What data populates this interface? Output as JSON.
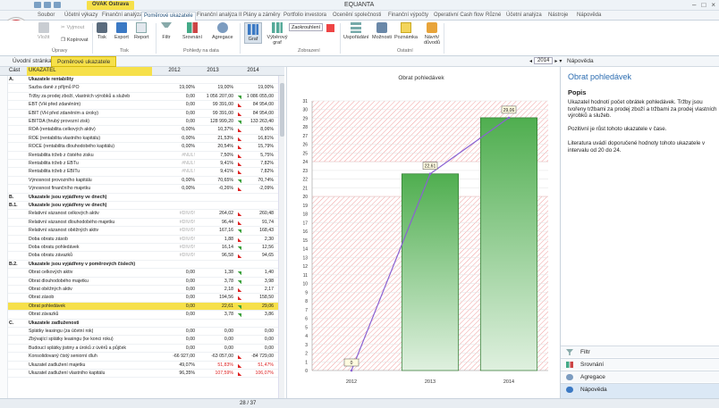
{
  "app": {
    "title": "EQUANTA",
    "context_badge": "OVAK Ostrava"
  },
  "tabs": [
    "Soubor",
    "Účetní výkazy",
    "Finanční analýza",
    "Poměrové ukazatele",
    "Finanční analýza II",
    "Plány a záměry",
    "Portfolio investora",
    "Ocenění společnosti",
    "Finanční výpočty",
    "Operativní Cash flow",
    "Různé",
    "Účetní analýza",
    "Nástroje",
    "Nápověda"
  ],
  "ribbon": {
    "buttons": {
      "vlozit": "Vložit",
      "vyjmout": "Vyjmout",
      "kopirovat": "Kopírovat",
      "tisk": "Tisk",
      "export": "Export",
      "report": "Report",
      "filtr": "Filtr",
      "srovnani": "Srovnání",
      "agregace": "Agregace",
      "graf": "Graf",
      "vyberovy": "Výběrový graf",
      "zaokrouhleni": "Zaokrouhlení",
      "uspoladani": "Uspořádání",
      "moznosti": "Možnosti",
      "poznamka": "Poznámka",
      "navrh": "Návrh/ důvodů"
    },
    "groups": {
      "upravy": "Úpravy",
      "tisk": "Tisk",
      "pohledy": "Pohledy na data",
      "zobrazeni": "Zobrazení",
      "ostatni": "Ostatní"
    }
  },
  "subbar": {
    "tab1": "Úvodní stránka",
    "tab2": "Poměrové ukazatele",
    "year": "2014",
    "right_title": "Nápověda"
  },
  "table": {
    "h_cast": "Část",
    "h_name": "UKAZATEL",
    "years": [
      "2012",
      "2013",
      "2014"
    ],
    "rows": [
      {
        "code": "A.",
        "name": "Ukazatele rentability",
        "v": [
          "",
          "",
          ""
        ],
        "sec": true
      },
      {
        "code": "",
        "name": "Sazba daně z příjmů PO",
        "v": [
          "19,00%",
          "19,00%",
          "19,00%"
        ]
      },
      {
        "code": "",
        "name": "Tržby za prodej zboží, vlastních výrobků a služeb",
        "v": [
          "0,00",
          "1 056 207,00",
          "1 086 055,00"
        ],
        "m": "up"
      },
      {
        "code": "",
        "name": "EBT (VH před zdaněním)",
        "v": [
          "0,00",
          "99 391,00",
          "84 954,00"
        ],
        "m": "dn"
      },
      {
        "code": "",
        "name": "EBIT (VH před zdaněním a úroky)",
        "v": [
          "0,00",
          "99 391,00",
          "84 954,00"
        ],
        "m": "dn"
      },
      {
        "code": "",
        "name": "EBITDA (hrubý provozní zisk)",
        "v": [
          "0,00",
          "128 999,20",
          "133 263,40"
        ],
        "m": "up"
      },
      {
        "code": "",
        "name": "ROA (rentabilita celkových aktiv)",
        "v": [
          "0,00%",
          "10,37%",
          "8,06%"
        ],
        "m": "dn"
      },
      {
        "code": "",
        "name": "ROE (rentabilita vlastního kapitálu)",
        "v": [
          "0,00%",
          "21,53%",
          "16,81%"
        ],
        "m": "dn"
      },
      {
        "code": "",
        "name": "ROCE (rentabilita dlouhodobého kapitálu)",
        "v": [
          "0,00%",
          "20,54%",
          "15,79%"
        ],
        "m": "dn"
      },
      {
        "code": "",
        "name": "Rentabilita tržeb z čistého zisku",
        "v": [
          "#NUL!",
          "7,50%",
          "5,75%"
        ],
        "m": "dn",
        "g": true
      },
      {
        "code": "",
        "name": "Rentabilita tržeb z EBTu",
        "v": [
          "#NUL!",
          "9,41%",
          "7,82%"
        ],
        "m": "dn",
        "g": true
      },
      {
        "code": "",
        "name": "Rentabilita tržeb z EBITu",
        "v": [
          "#NUL!",
          "9,41%",
          "7,82%"
        ],
        "m": "dn",
        "g": true
      },
      {
        "code": "",
        "name": "Výnosnost provozního kapitálu",
        "v": [
          "0,00%",
          "70,65%",
          "70,74%"
        ],
        "m": "up"
      },
      {
        "code": "",
        "name": "Výnosnost finančního majetku",
        "v": [
          "0,00%",
          "-0,26%",
          "-2,09%"
        ],
        "m": "dn"
      },
      {
        "code": "B.",
        "name": "Ukazatele jsou vyjádřeny ve dnech)",
        "v": [
          "",
          "",
          ""
        ],
        "sec": true
      },
      {
        "code": "B.1.",
        "name": "Ukazatele jsou vyjádřeny ve dnech)",
        "v": [
          "",
          "",
          ""
        ],
        "sec": true
      },
      {
        "code": "",
        "name": "Relativní vázanost celkových aktiv",
        "v": [
          "#DIV/0!",
          "264,02",
          "260,48"
        ],
        "m": "dn",
        "g": true
      },
      {
        "code": "",
        "name": "Relativní vázanost dlouhodobého majetku",
        "v": [
          "#DIV/0!",
          "96,44",
          "91,74"
        ],
        "m": "dn",
        "g": true
      },
      {
        "code": "",
        "name": "Relativní vázanost oběžných aktiv",
        "v": [
          "#DIV/0!",
          "167,16",
          "168,43"
        ],
        "m": "up",
        "g": true
      },
      {
        "code": "",
        "name": "Doba obratu zásob",
        "v": [
          "#DIV/0!",
          "1,88",
          "2,30"
        ],
        "m": "dn",
        "g": true
      },
      {
        "code": "",
        "name": "Doba obratu pohledávek",
        "v": [
          "#DIV/0!",
          "16,14",
          "12,56"
        ],
        "m": "up",
        "g": true
      },
      {
        "code": "",
        "name": "Doba obratu závazků",
        "v": [
          "#DIV/0!",
          "96,58",
          "94,65"
        ],
        "m": "dn",
        "g": true
      },
      {
        "code": "B.2.",
        "name": "Ukazatele jsou vyjádřeny v poměrových číslech)",
        "v": [
          "",
          "",
          ""
        ],
        "sec": true
      },
      {
        "code": "",
        "name": "Obrat celkových aktiv",
        "v": [
          "0,00",
          "1,38",
          "1,40"
        ],
        "m": "up"
      },
      {
        "code": "",
        "name": "Obrat dlouhodobého majetku",
        "v": [
          "0,00",
          "3,78",
          "3,98"
        ],
        "m": "up"
      },
      {
        "code": "",
        "name": "Obrat oběžných aktiv",
        "v": [
          "0,00",
          "2,18",
          "2,17"
        ],
        "m": "dn"
      },
      {
        "code": "",
        "name": "Obrat zásob",
        "v": [
          "0,00",
          "194,56",
          "158,50"
        ],
        "m": "dn"
      },
      {
        "code": "",
        "name": "Obrat pohledávek",
        "v": [
          "0,00",
          "22,61",
          "29,06"
        ],
        "m": "up",
        "hl": true
      },
      {
        "code": "",
        "name": "Obrat závazků",
        "v": [
          "0,00",
          "3,78",
          "3,86"
        ],
        "m": "up"
      },
      {
        "code": "C.",
        "name": "Ukazatele zadluženosti",
        "v": [
          "",
          "",
          ""
        ],
        "sec": true
      },
      {
        "code": "",
        "name": "Splátky leasingu (za účetní rok)",
        "v": [
          "0,00",
          "0,00",
          "0,00"
        ]
      },
      {
        "code": "",
        "name": "Zbývající splátky leasingu (ke konci roku)",
        "v": [
          "0,00",
          "0,00",
          "0,00"
        ]
      },
      {
        "code": "",
        "name": "Budoucí splátky jistiny a úroků z úvěrů a půjček",
        "v": [
          "0,00",
          "0,00",
          "0,00"
        ]
      },
      {
        "code": "",
        "name": "Konsolidovaný čistý seniorní dluh",
        "v": [
          "-66 927,00",
          "-63 057,00",
          "-84 729,00"
        ],
        "m": "dn"
      },
      {
        "code": "",
        "name": "Ukazatel zadlužení majetku",
        "v": [
          "49,07%",
          "51,83%",
          "51,47%"
        ],
        "m": "dn",
        "r": true
      },
      {
        "code": "",
        "name": "Ukazatel zadlužení vlastního kapitálu",
        "v": [
          "96,35%",
          "107,59%",
          "106,07%"
        ],
        "m": "dn",
        "r": true
      }
    ]
  },
  "chart_data": {
    "type": "bar",
    "title": "Obrat pohledávek",
    "categories": [
      "2012",
      "2013",
      "2014"
    ],
    "values": [
      0,
      22.61,
      29.06
    ],
    "data_labels": [
      "0",
      "22,61",
      "29,06"
    ],
    "ylim": [
      0,
      31
    ],
    "yticks": [
      0,
      1,
      2,
      3,
      4,
      5,
      6,
      7,
      8,
      9,
      10,
      11,
      12,
      13,
      14,
      15,
      16,
      17,
      18,
      19,
      20,
      21,
      22,
      23,
      24,
      25,
      26,
      27,
      28,
      29,
      30,
      31
    ],
    "grid": true,
    "optimal_band": [
      20,
      24
    ],
    "bar_color": "#5cb85c",
    "line_color": "#8a62d2"
  },
  "help": {
    "title": "Obrat pohledávek",
    "heading": "Popis",
    "p1": "Ukazatel hodnotí počet obrátek pohledávek. Tržby jsou tvořeny tržbami za prodej zboží a tržbami za prodej vlastních výrobků a služeb.",
    "p2": "Pozitivní je růst tohoto ukazatele v čase.",
    "p3": "Literatura uvádí doporučené hodnoty tohoto ukazatele v intervalu od 20 do 24.",
    "nav": [
      "Filtr",
      "Srovnání",
      "Agregace",
      "Nápověda"
    ]
  },
  "status": {
    "page": "28 / 37"
  }
}
